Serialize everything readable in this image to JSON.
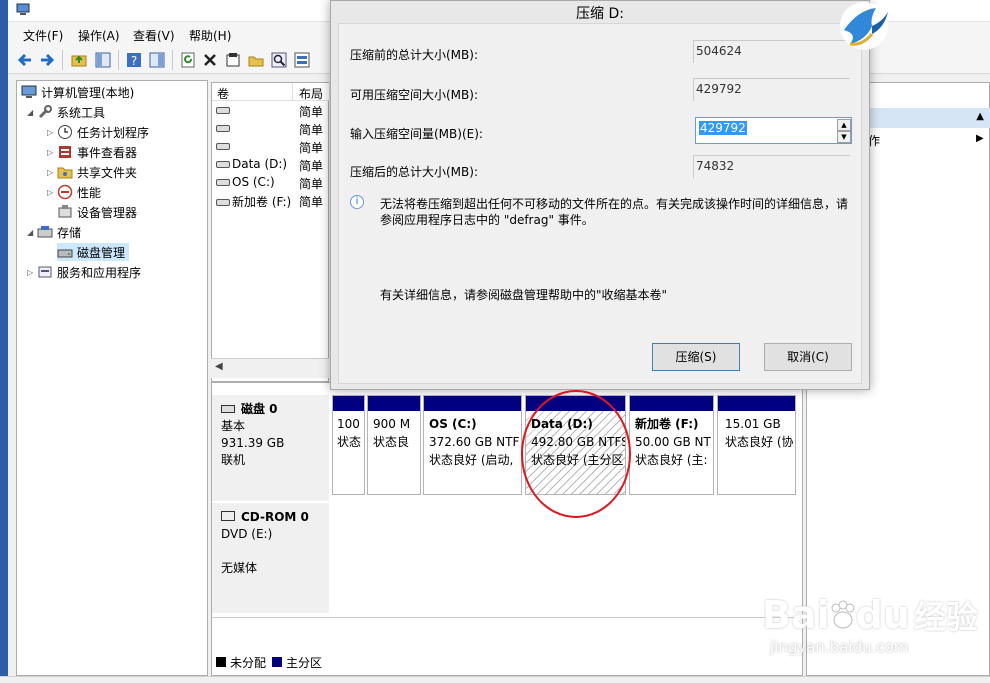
{
  "menu": {
    "file": "文件(F)",
    "action": "操作(A)",
    "view": "查看(V)",
    "help": "帮助(H)"
  },
  "tree": {
    "root": "计算机管理(本地)",
    "system_tools": "系统工具",
    "task_scheduler": "任务计划程序",
    "event_viewer": "事件查看器",
    "shared_folders": "共享文件夹",
    "performance": "性能",
    "device_manager": "设备管理器",
    "storage": "存储",
    "disk_management": "磁盘管理",
    "services_apps": "服务和应用程序"
  },
  "volume_list": {
    "col_volume": "卷",
    "col_layout": "布局",
    "rows": [
      {
        "name": "",
        "layout": "简单"
      },
      {
        "name": "",
        "layout": "简单"
      },
      {
        "name": "",
        "layout": "简单"
      },
      {
        "name": "Data (D:)",
        "layout": "简单"
      },
      {
        "name": "OS (C:)",
        "layout": "简单"
      },
      {
        "name": "新加卷 (F:)",
        "layout": "简单"
      }
    ]
  },
  "disks": {
    "disk0": {
      "name": "磁盘 0",
      "type": "基本",
      "size": "931.39 GB",
      "status": "联机"
    },
    "cdrom": {
      "name": "CD-ROM 0",
      "drive": "DVD (E:)",
      "status": "无媒体"
    }
  },
  "partitions": [
    {
      "title": "",
      "size": "100",
      "status": "状态"
    },
    {
      "title": "",
      "size": "900 M",
      "status": "状态良"
    },
    {
      "title": "OS  (C:)",
      "size": "372.60 GB NTF",
      "status": "状态良好 (启动,"
    },
    {
      "title": "Data  (D:)",
      "size": "492.80 GB NTFS",
      "status": "状态良好 (主分区"
    },
    {
      "title": "新加卷  (F:)",
      "size": "50.00 GB NT",
      "status": "状态良好 (主:"
    },
    {
      "title": "",
      "size": "15.01 GB",
      "status": "状态良好 (协"
    }
  ],
  "legend": {
    "unallocated": "未分配",
    "primary": "主分区"
  },
  "actions": {
    "more": "作"
  },
  "dialog": {
    "title": "压缩 D:",
    "total_before_label": "压缩前的总计大小(MB):",
    "total_before_value": "504624",
    "available_label": "可用压缩空间大小(MB):",
    "available_value": "429792",
    "input_label": "输入压缩空间量(MB)(E):",
    "input_value": "429792",
    "total_after_label": "压缩后的总计大小(MB):",
    "total_after_value": "74832",
    "info_line1": "无法将卷压缩到超出任何不可移动的文件所在的点。有关完成该操作时间的详细信息，请",
    "info_line2": "参阅应用程序日志中的 \"defrag\" 事件。",
    "help_text": "有关详细信息，请参阅磁盘管理帮助中的\"收缩基本卷\"",
    "ok": "压缩(S)",
    "cancel": "取消(C)"
  },
  "watermark": {
    "brand": "Bai",
    "brand2": "du",
    "jingyan": "经验",
    "url": "jingyan.baidu.com"
  },
  "colors": {
    "primary_partition": "#000080",
    "unallocated": "#000000",
    "highlight_circle": "#e3141b"
  }
}
